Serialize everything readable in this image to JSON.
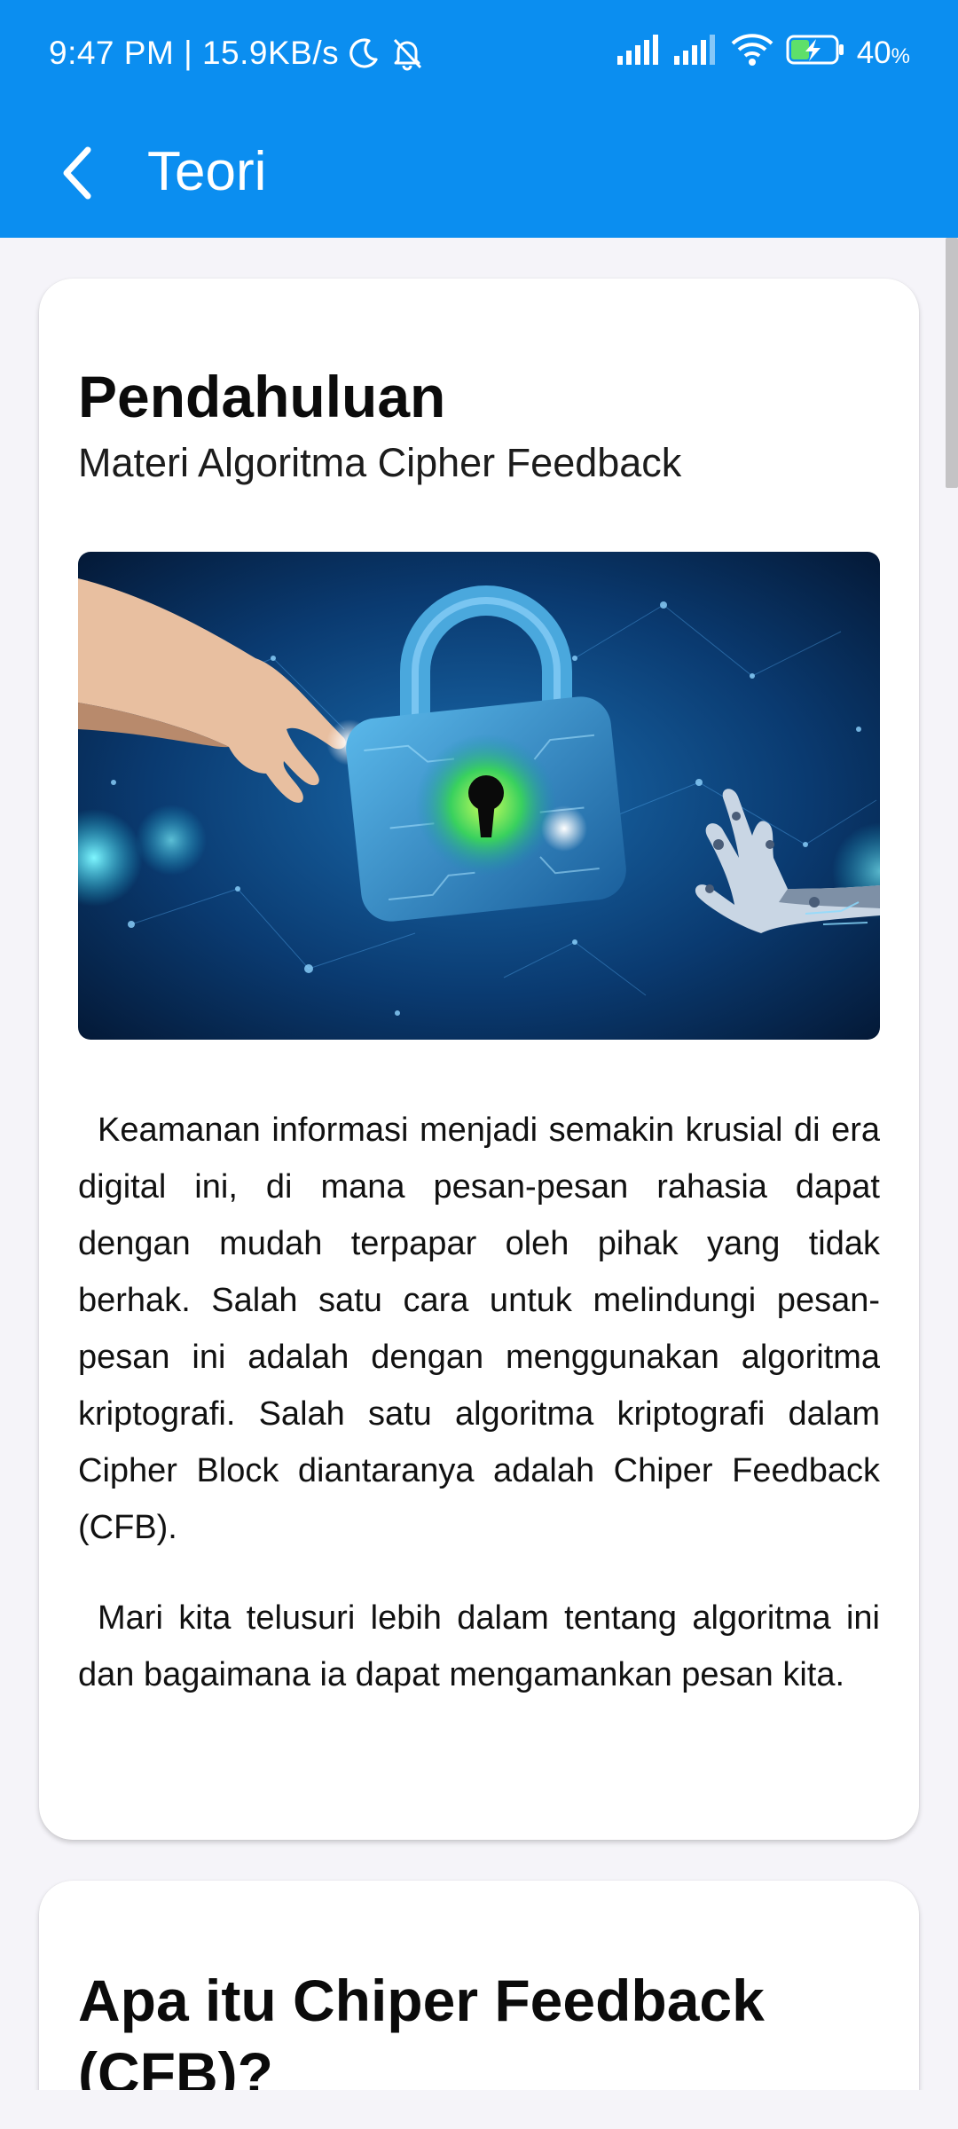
{
  "status_bar": {
    "time_speed": "9:47 PM | 15.9KB/s",
    "battery_percent": "40",
    "battery_unit": "%",
    "icons": [
      "moon-icon",
      "bell-off-icon",
      "signal-icon",
      "signal-icon",
      "wifi-icon",
      "battery-charging-icon"
    ]
  },
  "app_bar": {
    "title": "Teori",
    "back_icon": "chevron-left-icon",
    "color": "#0b8ef0"
  },
  "cards": [
    {
      "title": "Pendahuluan",
      "subtitle": "Materi Algoritma Cipher Feedback",
      "image": "padlock-hands-illustration",
      "paragraphs": [
        "Keamanan informasi menjadi semakin krusial di era digital ini, di mana pesan-pesan rahasia dapat dengan mudah terpapar oleh pihak yang tidak berhak. Salah satu cara untuk melindungi pesan-pesan ini adalah dengan menggunakan algoritma kriptografi. Salah satu algoritma kriptografi dalam Cipher Block diantaranya adalah Chiper Feedback (CFB).",
        "Mari kita telusuri lebih dalam tentang algoritma ini dan bagaimana ia dapat mengamankan pesan kita."
      ]
    },
    {
      "title": "Apa itu Chiper Feedback (CFB)?"
    }
  ]
}
